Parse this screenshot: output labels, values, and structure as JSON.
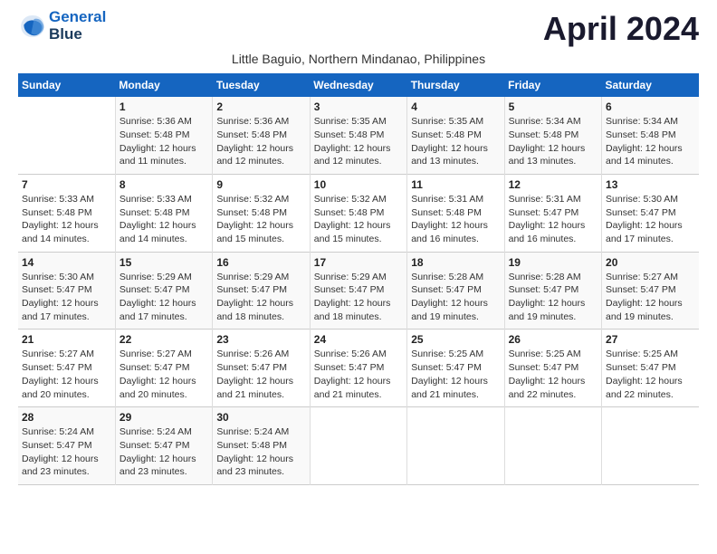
{
  "logo": {
    "line1": "General",
    "line2": "Blue"
  },
  "title": "April 2024",
  "subtitle": "Little Baguio, Northern Mindanao, Philippines",
  "days_of_week": [
    "Sunday",
    "Monday",
    "Tuesday",
    "Wednesday",
    "Thursday",
    "Friday",
    "Saturday"
  ],
  "weeks": [
    [
      {
        "num": "",
        "sunrise": "",
        "sunset": "",
        "daylight": ""
      },
      {
        "num": "1",
        "sunrise": "Sunrise: 5:36 AM",
        "sunset": "Sunset: 5:48 PM",
        "daylight": "Daylight: 12 hours and 11 minutes."
      },
      {
        "num": "2",
        "sunrise": "Sunrise: 5:36 AM",
        "sunset": "Sunset: 5:48 PM",
        "daylight": "Daylight: 12 hours and 12 minutes."
      },
      {
        "num": "3",
        "sunrise": "Sunrise: 5:35 AM",
        "sunset": "Sunset: 5:48 PM",
        "daylight": "Daylight: 12 hours and 12 minutes."
      },
      {
        "num": "4",
        "sunrise": "Sunrise: 5:35 AM",
        "sunset": "Sunset: 5:48 PM",
        "daylight": "Daylight: 12 hours and 13 minutes."
      },
      {
        "num": "5",
        "sunrise": "Sunrise: 5:34 AM",
        "sunset": "Sunset: 5:48 PM",
        "daylight": "Daylight: 12 hours and 13 minutes."
      },
      {
        "num": "6",
        "sunrise": "Sunrise: 5:34 AM",
        "sunset": "Sunset: 5:48 PM",
        "daylight": "Daylight: 12 hours and 14 minutes."
      }
    ],
    [
      {
        "num": "7",
        "sunrise": "Sunrise: 5:33 AM",
        "sunset": "Sunset: 5:48 PM",
        "daylight": "Daylight: 12 hours and 14 minutes."
      },
      {
        "num": "8",
        "sunrise": "Sunrise: 5:33 AM",
        "sunset": "Sunset: 5:48 PM",
        "daylight": "Daylight: 12 hours and 14 minutes."
      },
      {
        "num": "9",
        "sunrise": "Sunrise: 5:32 AM",
        "sunset": "Sunset: 5:48 PM",
        "daylight": "Daylight: 12 hours and 15 minutes."
      },
      {
        "num": "10",
        "sunrise": "Sunrise: 5:32 AM",
        "sunset": "Sunset: 5:48 PM",
        "daylight": "Daylight: 12 hours and 15 minutes."
      },
      {
        "num": "11",
        "sunrise": "Sunrise: 5:31 AM",
        "sunset": "Sunset: 5:48 PM",
        "daylight": "Daylight: 12 hours and 16 minutes."
      },
      {
        "num": "12",
        "sunrise": "Sunrise: 5:31 AM",
        "sunset": "Sunset: 5:47 PM",
        "daylight": "Daylight: 12 hours and 16 minutes."
      },
      {
        "num": "13",
        "sunrise": "Sunrise: 5:30 AM",
        "sunset": "Sunset: 5:47 PM",
        "daylight": "Daylight: 12 hours and 17 minutes."
      }
    ],
    [
      {
        "num": "14",
        "sunrise": "Sunrise: 5:30 AM",
        "sunset": "Sunset: 5:47 PM",
        "daylight": "Daylight: 12 hours and 17 minutes."
      },
      {
        "num": "15",
        "sunrise": "Sunrise: 5:29 AM",
        "sunset": "Sunset: 5:47 PM",
        "daylight": "Daylight: 12 hours and 17 minutes."
      },
      {
        "num": "16",
        "sunrise": "Sunrise: 5:29 AM",
        "sunset": "Sunset: 5:47 PM",
        "daylight": "Daylight: 12 hours and 18 minutes."
      },
      {
        "num": "17",
        "sunrise": "Sunrise: 5:29 AM",
        "sunset": "Sunset: 5:47 PM",
        "daylight": "Daylight: 12 hours and 18 minutes."
      },
      {
        "num": "18",
        "sunrise": "Sunrise: 5:28 AM",
        "sunset": "Sunset: 5:47 PM",
        "daylight": "Daylight: 12 hours and 19 minutes."
      },
      {
        "num": "19",
        "sunrise": "Sunrise: 5:28 AM",
        "sunset": "Sunset: 5:47 PM",
        "daylight": "Daylight: 12 hours and 19 minutes."
      },
      {
        "num": "20",
        "sunrise": "Sunrise: 5:27 AM",
        "sunset": "Sunset: 5:47 PM",
        "daylight": "Daylight: 12 hours and 19 minutes."
      }
    ],
    [
      {
        "num": "21",
        "sunrise": "Sunrise: 5:27 AM",
        "sunset": "Sunset: 5:47 PM",
        "daylight": "Daylight: 12 hours and 20 minutes."
      },
      {
        "num": "22",
        "sunrise": "Sunrise: 5:27 AM",
        "sunset": "Sunset: 5:47 PM",
        "daylight": "Daylight: 12 hours and 20 minutes."
      },
      {
        "num": "23",
        "sunrise": "Sunrise: 5:26 AM",
        "sunset": "Sunset: 5:47 PM",
        "daylight": "Daylight: 12 hours and 21 minutes."
      },
      {
        "num": "24",
        "sunrise": "Sunrise: 5:26 AM",
        "sunset": "Sunset: 5:47 PM",
        "daylight": "Daylight: 12 hours and 21 minutes."
      },
      {
        "num": "25",
        "sunrise": "Sunrise: 5:25 AM",
        "sunset": "Sunset: 5:47 PM",
        "daylight": "Daylight: 12 hours and 21 minutes."
      },
      {
        "num": "26",
        "sunrise": "Sunrise: 5:25 AM",
        "sunset": "Sunset: 5:47 PM",
        "daylight": "Daylight: 12 hours and 22 minutes."
      },
      {
        "num": "27",
        "sunrise": "Sunrise: 5:25 AM",
        "sunset": "Sunset: 5:47 PM",
        "daylight": "Daylight: 12 hours and 22 minutes."
      }
    ],
    [
      {
        "num": "28",
        "sunrise": "Sunrise: 5:24 AM",
        "sunset": "Sunset: 5:47 PM",
        "daylight": "Daylight: 12 hours and 23 minutes."
      },
      {
        "num": "29",
        "sunrise": "Sunrise: 5:24 AM",
        "sunset": "Sunset: 5:47 PM",
        "daylight": "Daylight: 12 hours and 23 minutes."
      },
      {
        "num": "30",
        "sunrise": "Sunrise: 5:24 AM",
        "sunset": "Sunset: 5:48 PM",
        "daylight": "Daylight: 12 hours and 23 minutes."
      },
      {
        "num": "",
        "sunrise": "",
        "sunset": "",
        "daylight": ""
      },
      {
        "num": "",
        "sunrise": "",
        "sunset": "",
        "daylight": ""
      },
      {
        "num": "",
        "sunrise": "",
        "sunset": "",
        "daylight": ""
      },
      {
        "num": "",
        "sunrise": "",
        "sunset": "",
        "daylight": ""
      }
    ]
  ]
}
